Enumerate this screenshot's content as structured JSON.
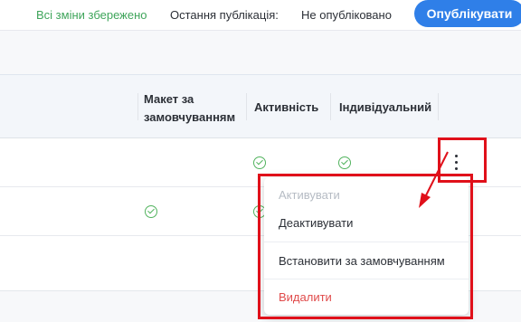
{
  "topbar": {
    "saved_status": "Всі зміни збережено",
    "last_publication_label": "Остання публікація:",
    "publication_status": "Не опубліковано",
    "publish_button": "Опублікувати"
  },
  "table": {
    "columns": [
      "Макет за замовчуванням",
      "Активність",
      "Індивідуальний"
    ],
    "rows": [
      {
        "default": false,
        "active": true,
        "individual": true
      },
      {
        "default": true,
        "active": true,
        "individual": false
      }
    ]
  },
  "context_menu": {
    "items": [
      {
        "label": "Активувати",
        "disabled": true
      },
      {
        "label": "Деактивувати",
        "disabled": false
      },
      {
        "label": "Встановити за замовчуванням",
        "disabled": false
      },
      {
        "label": "Видалити",
        "disabled": false,
        "danger": true
      }
    ]
  },
  "colors": {
    "accent": "#2f7fe8",
    "success": "#3fa55b",
    "danger": "#e04b4b",
    "highlight": "#e0101a"
  }
}
